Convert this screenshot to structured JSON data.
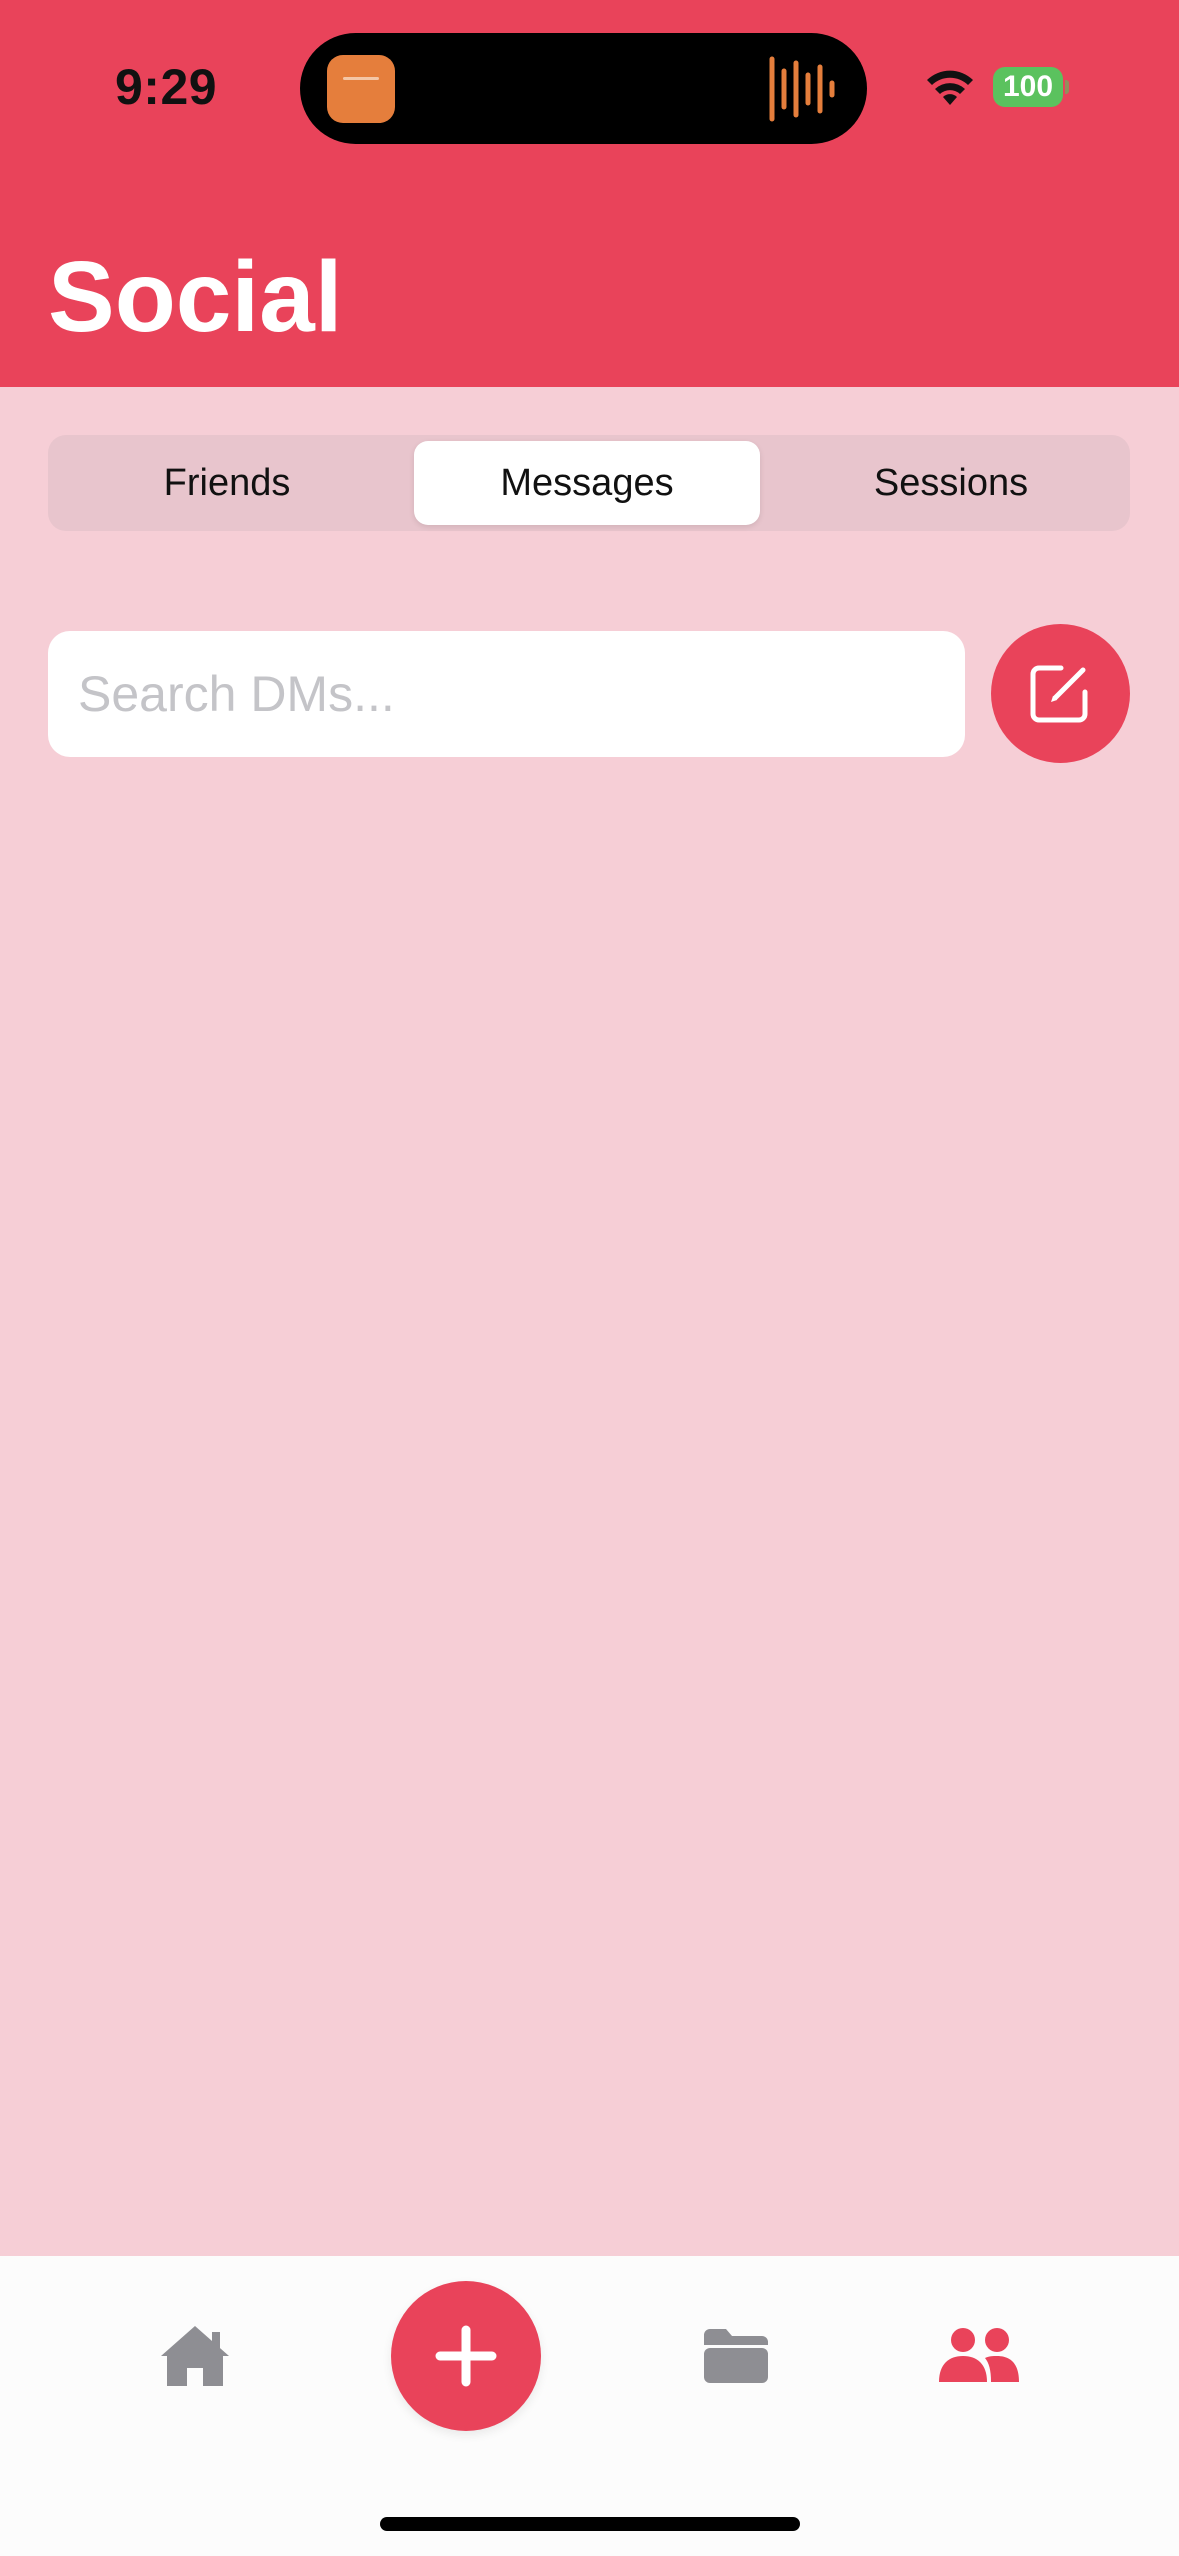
{
  "status_bar": {
    "time": "9:29",
    "battery": "100",
    "icons": [
      "wifi-icon",
      "battery-icon",
      "audio-waveform-icon",
      "app-icon"
    ]
  },
  "header": {
    "title": "Social"
  },
  "tabs": [
    {
      "label": "Friends",
      "selected": false
    },
    {
      "label": "Messages",
      "selected": true
    },
    {
      "label": "Sessions",
      "selected": false
    }
  ],
  "search": {
    "placeholder": "Search DMs...",
    "value": ""
  },
  "compose": {
    "icon": "compose-icon"
  },
  "tab_bar": {
    "items": [
      {
        "icon": "home-icon",
        "active": false
      },
      {
        "icon": "plus-icon",
        "active": false
      },
      {
        "icon": "folder-icon",
        "active": false
      },
      {
        "icon": "people-icon",
        "active": true
      }
    ]
  },
  "colors": {
    "accent": "#E9435A",
    "background": "#F6CED6",
    "inactive_icon": "#8E8E93",
    "battery": "#5BC25E"
  }
}
